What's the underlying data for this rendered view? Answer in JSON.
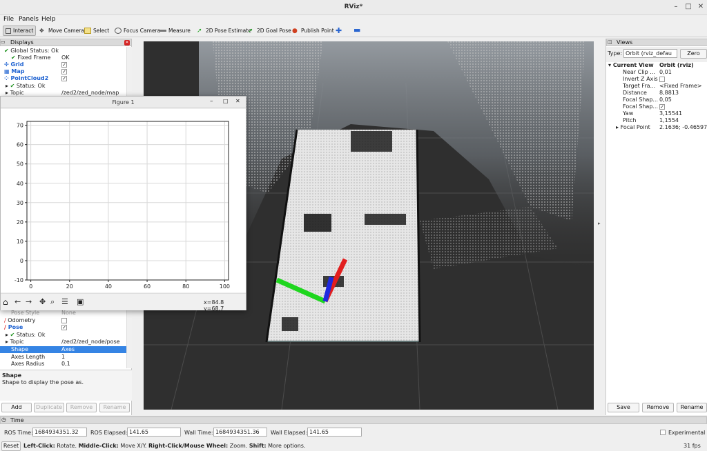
{
  "window": {
    "title": "RViz*"
  },
  "menu": [
    "File",
    "Panels",
    "Help"
  ],
  "toolbar": {
    "tools": [
      {
        "label": "Interact",
        "icon": "interact-icon"
      },
      {
        "label": "Move Camera",
        "icon": "move-camera-icon"
      },
      {
        "label": "Select",
        "icon": "select-icon"
      },
      {
        "label": "Focus Camera",
        "icon": "focus-camera-icon"
      },
      {
        "label": "Measure",
        "icon": "measure-icon"
      },
      {
        "label": "2D Pose Estimate",
        "icon": "pose-estimate-icon"
      },
      {
        "label": "2D Goal Pose",
        "icon": "goal-pose-icon"
      },
      {
        "label": "Publish Point",
        "icon": "publish-point-icon"
      }
    ]
  },
  "displays": {
    "title": "Displays",
    "global_status": "Global Status: Ok",
    "fixed_frame_label": "Fixed Frame",
    "fixed_frame_value": "OK",
    "grid": "Grid",
    "map": "Map",
    "pointcloud": "PointCloud2",
    "pc_status": "Status: Ok",
    "pc_topic_label": "Topic",
    "pc_topic_value": "/zed2/zed_node/map",
    "pose_style_label": "Pose Style",
    "pose_style_value": "None",
    "odometry": "Odometry",
    "pose": "Pose",
    "pose_status": "Status: Ok",
    "pose_topic_label": "Topic",
    "pose_topic_value": "/zed2/zed_node/pose",
    "shape_label": "Shape",
    "shape_value": "Axes",
    "axes_length_label": "Axes Length",
    "axes_length_value": "1",
    "axes_radius_label": "Axes Radius",
    "axes_radius_value": "0,1",
    "desc_title": "Shape",
    "desc_text": "Shape to display the pose as.",
    "buttons": {
      "add": "Add",
      "duplicate": "Duplicate",
      "remove": "Remove",
      "rename": "Rename"
    }
  },
  "figure": {
    "title": "Figure 1",
    "coords": "x=84.8 y=68.7"
  },
  "chart_data": {
    "type": "scatter",
    "xlim": [
      -2,
      102
    ],
    "ylim": [
      -10,
      72
    ],
    "xticks": [
      0,
      20,
      40,
      60,
      80,
      100
    ],
    "yticks": [
      -10,
      0,
      10,
      20,
      30,
      40,
      50,
      60,
      70
    ],
    "grid": true
  },
  "views": {
    "title": "Views",
    "type_label": "Type:",
    "type_value": "Orbit (rviz_defau",
    "zero": "Zero",
    "current_view_label": "Current View",
    "current_view_value": "Orbit (rviz)",
    "props": [
      {
        "label": "Near Clip ...",
        "value": "0,01"
      },
      {
        "label": "Invert Z Axis",
        "value": ""
      },
      {
        "label": "Target Fra...",
        "value": "<Fixed Frame>"
      },
      {
        "label": "Distance",
        "value": "8,8813"
      },
      {
        "label": "Focal Shap...",
        "value": "0,05"
      },
      {
        "label": "Focal Shap...",
        "value": ""
      },
      {
        "label": "Yaw",
        "value": "3,15541"
      },
      {
        "label": "Pitch",
        "value": "1,1554"
      },
      {
        "label": "Focal Point",
        "value": "2.1636; -0.46597..."
      }
    ],
    "buttons": {
      "save": "Save",
      "remove": "Remove",
      "rename": "Rename"
    }
  },
  "time": {
    "title": "Time",
    "ros_time_label": "ROS Time:",
    "ros_time": "1684934351.32",
    "ros_elapsed_label": "ROS Elapsed:",
    "ros_elapsed": "141.65",
    "wall_time_label": "Wall Time:",
    "wall_time": "1684934351.36",
    "wall_elapsed_label": "Wall Elapsed:",
    "wall_elapsed": "141.65",
    "experimental": "Experimental"
  },
  "statusbar": {
    "reset": "Reset",
    "hint_b1": "Left-Click:",
    "hint_t1": " Rotate. ",
    "hint_b2": "Middle-Click:",
    "hint_t2": " Move X/Y. ",
    "hint_b3": "Right-Click/Mouse Wheel:",
    "hint_t3": " Zoom. ",
    "hint_b4": "Shift:",
    "hint_t4": " More options.",
    "fps": "31 fps"
  }
}
